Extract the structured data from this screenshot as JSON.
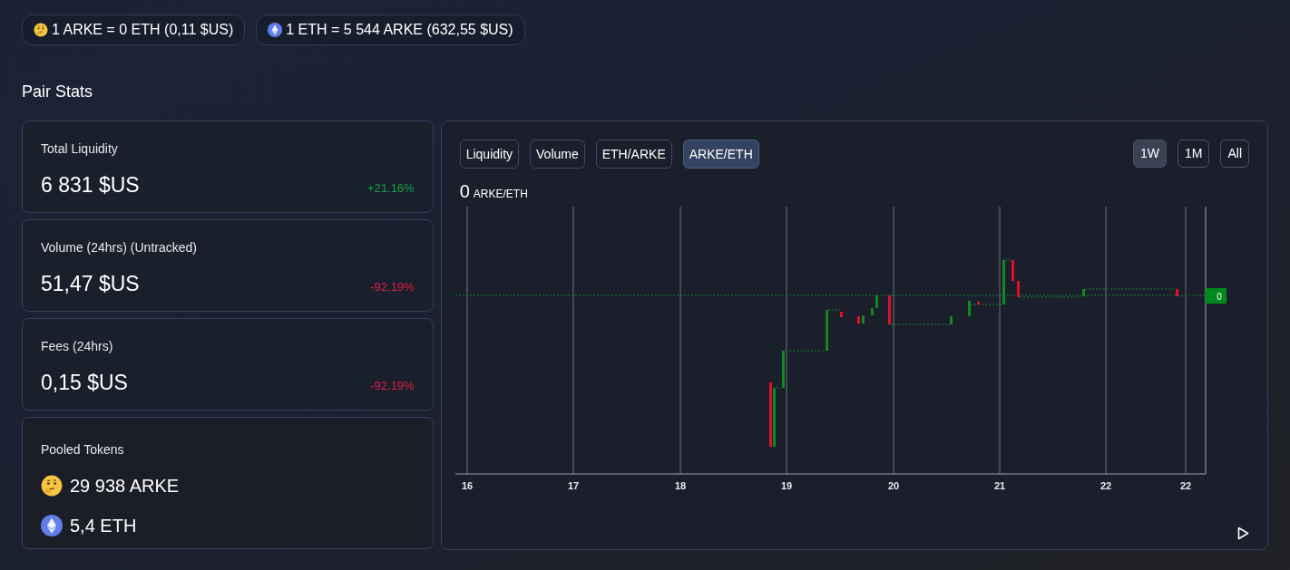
{
  "rates": [
    {
      "kind": "arke",
      "text": "1 ARKE = 0 ETH (0,11 $US)"
    },
    {
      "kind": "eth",
      "text": "1 ETH = 5 544 ARKE (632,55 $US)"
    }
  ],
  "section_title": "Pair Stats",
  "stats": [
    {
      "title": "Total Liquidity",
      "value": "6 831 $US",
      "change": "+21.16%",
      "kind": "up"
    },
    {
      "title": "Volume (24hrs) (Untracked)",
      "value": "51,47 $US",
      "change": "-92.19%",
      "kind": "down"
    },
    {
      "title": "Fees (24hrs)",
      "value": "0,15 $US",
      "change": "-92.19%",
      "kind": "down"
    }
  ],
  "pooled_tokens": {
    "title": "Pooled Tokens",
    "items": [
      {
        "kind": "arke",
        "text": "29 938 ARKE"
      },
      {
        "kind": "eth",
        "text": "5,4 ETH"
      }
    ]
  },
  "chart": {
    "tabs": [
      {
        "label": "Liquidity",
        "selected": false
      },
      {
        "label": "Volume",
        "selected": false
      },
      {
        "label": "ETH/ARKE",
        "selected": false
      },
      {
        "label": "ARKE/ETH",
        "selected": true
      }
    ],
    "ranges": [
      {
        "label": "1W",
        "selected": true
      },
      {
        "label": "1M",
        "selected": false
      },
      {
        "label": "All",
        "selected": false
      }
    ],
    "value": "0",
    "unit": "ARKE/ETH",
    "price_tag": "0",
    "x_axis_labels": [
      "16",
      "17",
      "18",
      "19",
      "20",
      "21",
      "22",
      "22"
    ]
  }
}
